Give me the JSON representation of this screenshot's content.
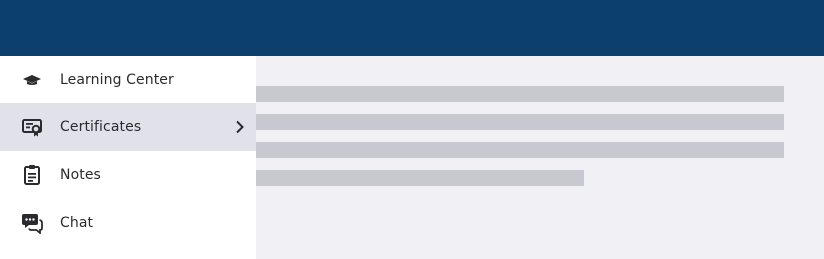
{
  "header": {
    "background_color": "#0d3f6d"
  },
  "menu": {
    "items": [
      {
        "label": "Learning Center",
        "icon": "graduation-cap-icon",
        "active": false
      },
      {
        "label": "Certificates",
        "icon": "certificate-icon",
        "active": true
      },
      {
        "label": "Notes",
        "icon": "clipboard-notes-icon",
        "active": false
      },
      {
        "label": "Chat",
        "icon": "chat-bubbles-icon",
        "active": false
      }
    ],
    "active_color": "#e1e1e9"
  },
  "content": {
    "state": "loading"
  }
}
